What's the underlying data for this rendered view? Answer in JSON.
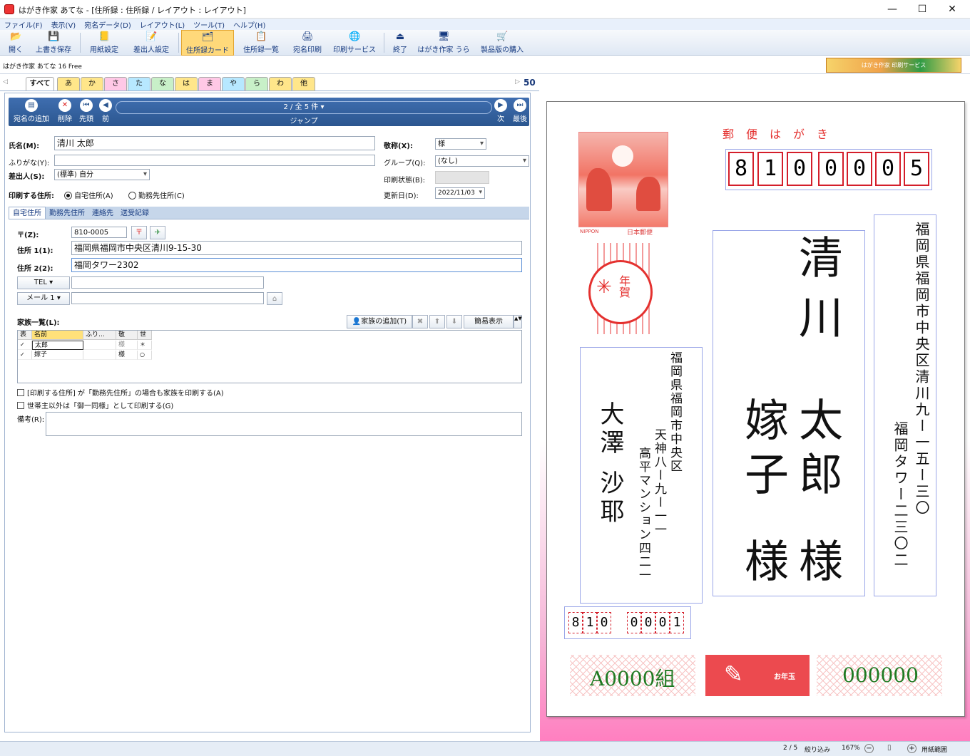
{
  "window": {
    "title": "はがき作家 あてな - [住所録 : 住所録 / レイアウト : レイアウト]",
    "min": "—",
    "max": "☐",
    "close": "✕"
  },
  "menu": [
    "ファイル(F)",
    "表示(V)",
    "宛名データ(D)",
    "レイアウト(L)",
    "ツール(T)",
    "ヘルプ(H)"
  ],
  "toolbar": [
    {
      "label": "開く",
      "icon": "folder-icon",
      "glyph": "📂"
    },
    {
      "label": "上書き保存",
      "icon": "save-icon",
      "glyph": "💾"
    },
    {
      "label": "用紙設定",
      "icon": "paper-icon",
      "glyph": "📒"
    },
    {
      "label": "差出人設定",
      "icon": "sender-icon",
      "glyph": "📝"
    },
    {
      "label": "住所録カード",
      "icon": "card-icon",
      "glyph": "🗂"
    },
    {
      "label": "住所録一覧",
      "icon": "list-icon",
      "glyph": "📋"
    },
    {
      "label": "宛名印刷",
      "icon": "print-icon",
      "glyph": "🖨"
    },
    {
      "label": "印刷サービス",
      "icon": "service-icon",
      "glyph": "🌐"
    },
    {
      "label": "終了",
      "icon": "exit-icon",
      "glyph": "⏏"
    },
    {
      "label": "はがき作家 うら",
      "icon": "ura-icon",
      "glyph": "🖥"
    },
    {
      "label": "製品版の購入",
      "icon": "cart-icon",
      "glyph": "🛒"
    }
  ],
  "status": {
    "version": "はがき作家 あてな 16 Free"
  },
  "banner_text": "はがき作家 印刷サービス",
  "kana_tabs": [
    "すべて",
    "あ",
    "か",
    "さ",
    "た",
    "な",
    "は",
    "ま",
    "や",
    "ら",
    "わ",
    "他"
  ],
  "kana_colors": [
    "#ffffff",
    "#ffe68a",
    "#ffe68a",
    "#ffc8e6",
    "#b7e8ff",
    "#c8f0c8",
    "#ffe68a",
    "#ffc8e6",
    "#b7e8ff",
    "#c8f0c8",
    "#ffe68a",
    "#ffe68a"
  ],
  "record_count_box": "50",
  "nav": {
    "add": "宛名の追加",
    "delete": "削除",
    "first": "先頭",
    "prev": "前",
    "position": "2 / 全 5 件",
    "jump": "ジャンプ",
    "next": "次",
    "last": "最後"
  },
  "form": {
    "name_label": "氏名(M):",
    "name_value": "清川 太郎",
    "honorific_label": "敬称(X):",
    "honorific_value": "様",
    "furigana_label": "ふりがな(Y):",
    "furigana_value": "",
    "group_label": "グループ(Q):",
    "group_value": "(なし)",
    "sender_label": "差出人(S):",
    "sender_value": "(標準) 自分",
    "print_status_label": "印刷状態(B):",
    "print_addr_label": "印刷する住所:",
    "print_addr_home": "自宅住所(A)",
    "print_addr_work": "勤務先住所(C)",
    "updated_label": "更新日(D):",
    "updated_value": "2022/11/03"
  },
  "subtabs": [
    "自宅住所",
    "勤務先住所",
    "連絡先",
    "送受記録"
  ],
  "address": {
    "zip_label": "〒(Z):",
    "zip_value": "810-0005",
    "addr1_label": "住所 1(1):",
    "addr1_value": "福岡県福岡市中央区清川9-15-30",
    "addr2_label": "住所 2(2):",
    "addr2_value": "福岡タワー2302",
    "tel_label": "TEL",
    "mail_label": "メール 1"
  },
  "family": {
    "label": "家族一覧(L):",
    "add_button": "家族の追加(T)",
    "simple_view": "簡易表示",
    "columns": [
      "表",
      "名前",
      "ふり…",
      "敬",
      "世"
    ],
    "rows": [
      {
        "check": "✓",
        "name": "太郎",
        "furi": "",
        "hon": "様",
        "head": "＊"
      },
      {
        "check": "✓",
        "name": "嫁子",
        "furi": "",
        "hon": "様",
        "head": "○"
      }
    ]
  },
  "options": {
    "opt1": "[印刷する住所] が「勤務先住所」の場合も家族を印刷する(A)",
    "opt2": "世帯主以外は「御一同様」として印刷する(G)",
    "remarks_label": "備考(R):"
  },
  "postcard": {
    "header": "郵便はがき",
    "zip_digits": [
      "8",
      "1",
      "0",
      "0",
      "0",
      "0",
      "5"
    ],
    "recipient_address1": "福岡県福岡市中央区清川九ー一五ー三〇",
    "recipient_address2": "福岡タワー二三〇二",
    "recipient_family": "清川",
    "recipient_name1": "太郎",
    "recipient_name2": "嫁子",
    "recipient_hon1": "様",
    "recipient_hon2": "様",
    "sender_address1": "福岡県福岡市中央区",
    "sender_address2": "天神八ー九ー一一",
    "sender_address3": "高平マンション四二一",
    "sender_name": "大澤 沙耶",
    "sender_zip": [
      "8",
      "1",
      "0",
      "0",
      "0",
      "0",
      "1"
    ],
    "stamp_nippon": "NIPPON",
    "stamp_jp": "日本郵便",
    "nenga": "年賀",
    "lottery_group": "A0000組",
    "lottery_number": "000000",
    "otoshidama": "お年玉"
  },
  "bottom": {
    "pages": "2 / 5",
    "filter": "絞り込み",
    "zoom": "167%",
    "paper_range": "用紙範囲"
  }
}
